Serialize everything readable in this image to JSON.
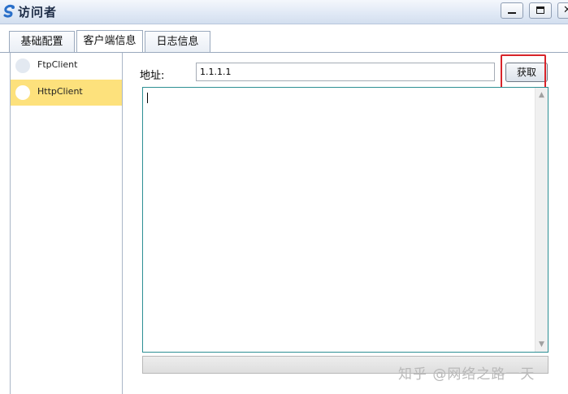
{
  "window": {
    "title": "访问者",
    "icon": "app-logo-icon",
    "controls": {
      "minimize": "minimize-icon",
      "maximize": "maximize-icon",
      "close": "close-icon"
    }
  },
  "tabs": [
    {
      "label": "基础配置",
      "active": false
    },
    {
      "label": "客户端信息",
      "active": true
    },
    {
      "label": "日志信息",
      "active": false
    }
  ],
  "clients": [
    {
      "label": "FtpClient",
      "selected": false
    },
    {
      "label": "HttpClient",
      "selected": true
    }
  ],
  "address": {
    "label": "地址:",
    "value": "1.1.1.1"
  },
  "fetch_button": {
    "label": "获取"
  },
  "output": {
    "value": ""
  },
  "watermark": "知乎 @网络之路一天",
  "colors": {
    "selected_bg": "#fde17c",
    "highlight_border": "#d8242a",
    "output_border": "#2d8f94",
    "titlebar": "#dfe8f5"
  }
}
